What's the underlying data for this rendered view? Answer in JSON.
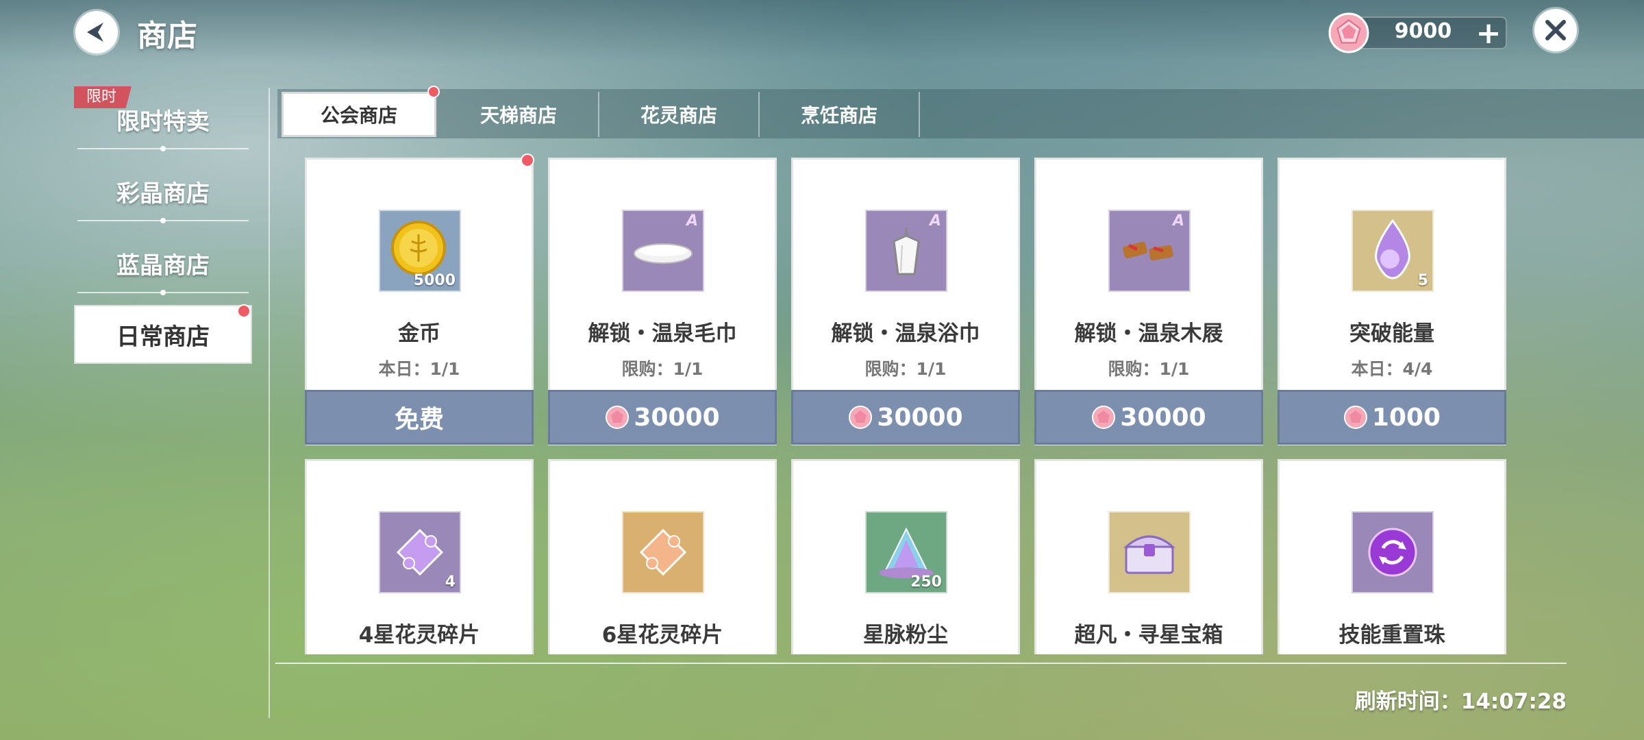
{
  "header": {
    "title": "商店",
    "currency_amount": "9000"
  },
  "sidebar": {
    "badge": "限时",
    "items": [
      {
        "label": "限时特卖"
      },
      {
        "label": "彩晶商店"
      },
      {
        "label": "蓝晶商店"
      },
      {
        "label": "日常商店"
      }
    ],
    "active_index": 3
  },
  "tabs": [
    {
      "label": "公会商店"
    },
    {
      "label": "天梯商店"
    },
    {
      "label": "花灵商店"
    },
    {
      "label": "烹饪商店"
    }
  ],
  "items": [
    {
      "name": "金币",
      "limit": "本日：1/1",
      "price": "免费",
      "qty": "5000",
      "icon": "gold-coin-icon"
    },
    {
      "name": "解锁・温泉毛巾",
      "limit": "限购：1/1",
      "price": "30000",
      "rank": "A",
      "icon": "towel-icon"
    },
    {
      "name": "解锁・温泉浴巾",
      "limit": "限购：1/1",
      "price": "30000",
      "rank": "A",
      "icon": "bath-towel-icon"
    },
    {
      "name": "解锁・温泉木屐",
      "limit": "限购：1/1",
      "price": "30000",
      "rank": "A",
      "icon": "wooden-clogs-icon"
    },
    {
      "name": "突破能量",
      "limit": "本日：4/4",
      "price": "1000",
      "qty": "5",
      "icon": "energy-drop-icon"
    },
    {
      "name": "4星花灵碎片",
      "qty": "4",
      "icon": "purple-puzzle-icon"
    },
    {
      "name": "6星花灵碎片",
      "icon": "orange-puzzle-icon"
    },
    {
      "name": "星脉粉尘",
      "qty": "250",
      "icon": "stardust-icon"
    },
    {
      "name": "超凡・寻星宝箱",
      "icon": "treasure-chest-icon"
    },
    {
      "name": "技能重置珠",
      "icon": "reset-orb-icon"
    }
  ],
  "footer": {
    "refresh": "刷新时间：14:07:28"
  }
}
